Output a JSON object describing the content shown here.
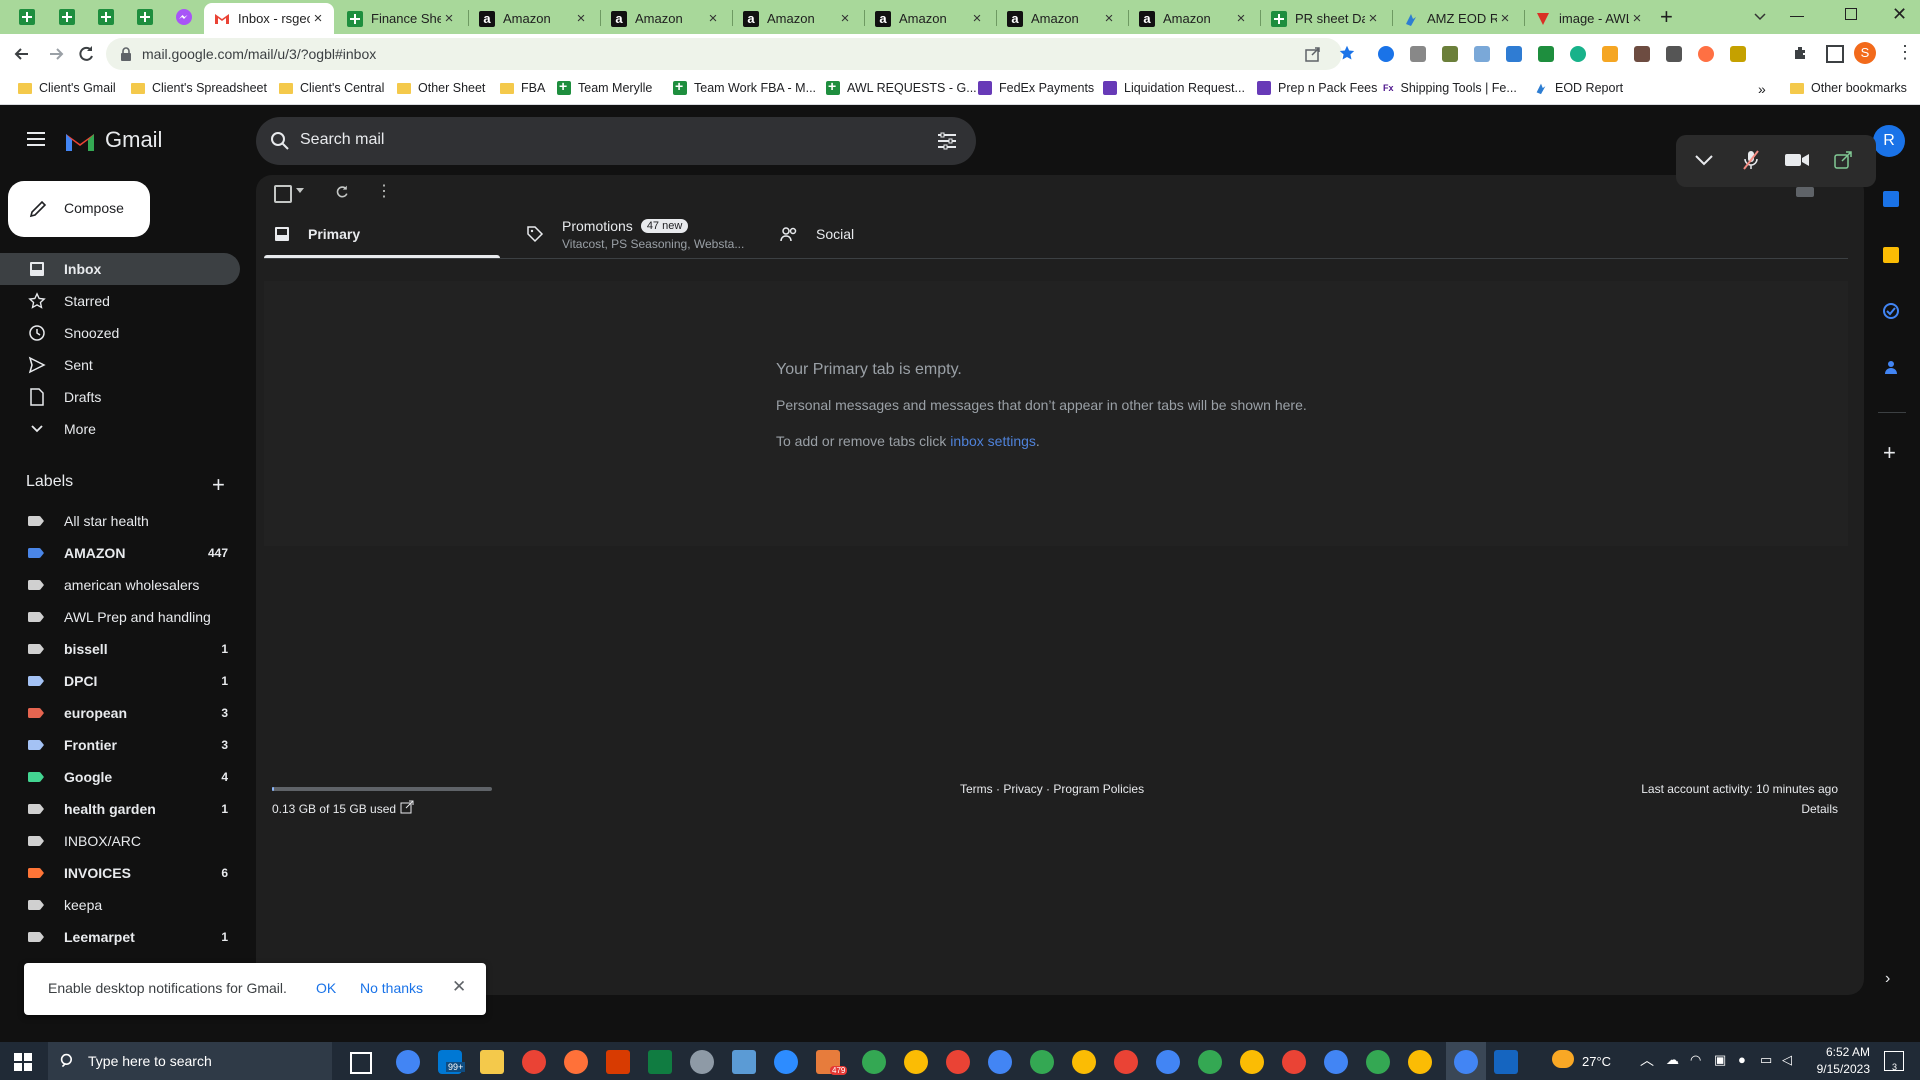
{
  "browser": {
    "tabs": [
      {
        "title": "Inbox - rsgeo",
        "icon": "gmail-icon",
        "active": true
      },
      {
        "title": "Finance Shee",
        "icon": "sheets-icon"
      },
      {
        "title": "Amazon",
        "icon": "amazon-icon"
      },
      {
        "title": "Amazon",
        "icon": "amazon-icon"
      },
      {
        "title": "Amazon",
        "icon": "amazon-icon"
      },
      {
        "title": "Amazon",
        "icon": "amazon-icon"
      },
      {
        "title": "Amazon",
        "icon": "amazon-icon"
      },
      {
        "title": "Amazon",
        "icon": "amazon-icon"
      },
      {
        "title": "PR sheet Da",
        "icon": "sheets-icon"
      },
      {
        "title": "AMZ EOD Re",
        "icon": "app-icon"
      },
      {
        "title": "image - AWL",
        "icon": "forms-icon"
      }
    ],
    "new_tab_label": "+",
    "url": "mail.google.com/mail/u/3/?ogbl#inbox",
    "profile_initial": "S",
    "bookmarks": [
      {
        "label": "Client's Gmail",
        "icon": "folder"
      },
      {
        "label": "Client's Spreadsheet",
        "icon": "folder"
      },
      {
        "label": "Client's Central",
        "icon": "folder"
      },
      {
        "label": "Other Sheet",
        "icon": "folder"
      },
      {
        "label": "FBA",
        "icon": "folder"
      },
      {
        "label": "Team Merylle",
        "icon": "sheets"
      },
      {
        "label": "Team Work FBA - M...",
        "icon": "sheets"
      },
      {
        "label": "AWL REQUESTS - G...",
        "icon": "sheets"
      },
      {
        "label": "FedEx Payments",
        "icon": "forms"
      },
      {
        "label": "Liquidation Request...",
        "icon": "forms"
      },
      {
        "label": "Prep n Pack Fees",
        "icon": "forms"
      },
      {
        "label": "Shipping Tools | Fe...",
        "icon": "fedex"
      },
      {
        "label": "EOD Report",
        "icon": "app"
      }
    ],
    "bookmarks_more": "»",
    "other_bookmarks": "Other bookmarks"
  },
  "gmail": {
    "logo_text": "Gmail",
    "search_placeholder": "Search mail",
    "compose_label": "Compose",
    "account_initial": "R",
    "nav": [
      {
        "label": "Inbox",
        "icon": "inbox-icon",
        "active": true
      },
      {
        "label": "Starred",
        "icon": "star-icon"
      },
      {
        "label": "Snoozed",
        "icon": "clock-icon"
      },
      {
        "label": "Sent",
        "icon": "send-icon"
      },
      {
        "label": "Drafts",
        "icon": "draft-icon"
      },
      {
        "label": "More",
        "icon": "chevron-down-icon"
      }
    ],
    "labels_title": "Labels",
    "labels": [
      {
        "name": "All star health",
        "count": "",
        "color": "#d0d0d0",
        "bold": false
      },
      {
        "name": "AMAZON",
        "count": "447",
        "color": "#4a86e8",
        "bold": true
      },
      {
        "name": "american wholesalers",
        "count": "",
        "color": "#d0d0d0",
        "bold": false
      },
      {
        "name": "AWL Prep and handling",
        "count": "",
        "color": "#d0d0d0",
        "bold": false
      },
      {
        "name": "bissell",
        "count": "1",
        "color": "#d0d0d0",
        "bold": true
      },
      {
        "name": "DPCI",
        "count": "1",
        "color": "#a4c2f4",
        "bold": true
      },
      {
        "name": "european",
        "count": "3",
        "color": "#e66550",
        "bold": true
      },
      {
        "name": "Frontier",
        "count": "3",
        "color": "#a4c2f4",
        "bold": true
      },
      {
        "name": "Google",
        "count": "4",
        "color": "#43d692",
        "bold": true
      },
      {
        "name": "health garden",
        "count": "1",
        "color": "#d0d0d0",
        "bold": true
      },
      {
        "name": "INBOX/ARC",
        "count": "",
        "color": "#d0d0d0",
        "bold": false
      },
      {
        "name": "INVOICES",
        "count": "6",
        "color": "#ff7537",
        "bold": true
      },
      {
        "name": "keepa",
        "count": "",
        "color": "#d0d0d0",
        "bold": false
      },
      {
        "name": "Leemarpet",
        "count": "1",
        "color": "#d0d0d0",
        "bold": true
      }
    ],
    "category_tabs": [
      {
        "label": "Primary",
        "icon": "inbox-icon",
        "active": true
      },
      {
        "label": "Promotions",
        "sub": "Vitacost, PS Seasoning, Websta...",
        "badge": "47 new",
        "icon": "tag-icon"
      },
      {
        "label": "Social",
        "icon": "people-icon"
      }
    ],
    "empty": {
      "title": "Your Primary tab is empty.",
      "line1": "Personal messages and messages that don’t appear in other tabs will be shown here.",
      "line2_prefix": "To add or remove tabs click ",
      "line2_link": "inbox settings",
      "line2_suffix": "."
    },
    "footer": {
      "storage": "0.13 GB of 15 GB used",
      "storage_fraction": 0.009,
      "terms": "Terms",
      "privacy": "Privacy",
      "policies": "Program Policies",
      "sep": "·",
      "activity": "Last account activity: 10 minutes ago",
      "details": "Details"
    },
    "notification": {
      "text": "Enable desktop notifications for Gmail.",
      "ok": "OK",
      "no_thanks": "No thanks"
    }
  },
  "taskbar": {
    "search_placeholder": "Type here to search",
    "mail_badge": "99+",
    "app_badge": "479",
    "weather": "27°C",
    "time": "6:52 AM",
    "date": "9/15/2023",
    "notif_count": "3"
  }
}
